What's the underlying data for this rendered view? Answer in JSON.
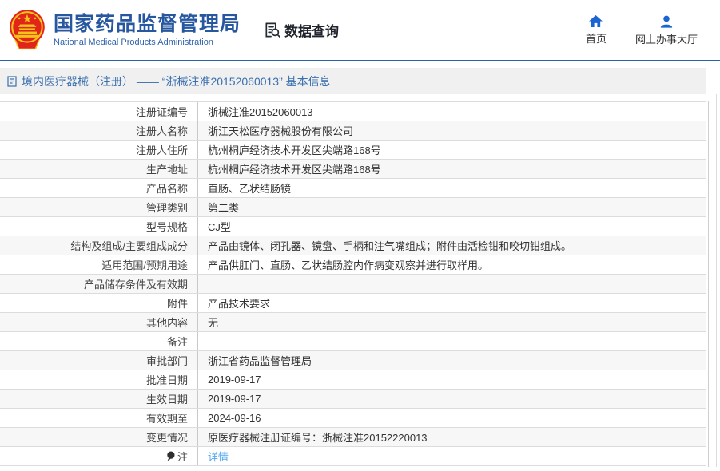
{
  "header": {
    "org_title": "国家药品监督管理局",
    "org_subtitle": "National Medical Products Administration",
    "section_title": "数据查询",
    "nav": [
      {
        "label": "首页",
        "icon": "home-icon"
      },
      {
        "label": "网上办事大厅",
        "icon": "user-icon"
      }
    ]
  },
  "breadcrumb": {
    "icon": "document-icon",
    "text": "境内医疗器械（注册） —— “浙械注准20152060013” 基本信息"
  },
  "table": {
    "rows": [
      {
        "label": "注册证编号",
        "value": "浙械注准20152060013"
      },
      {
        "label": "注册人名称",
        "value": "浙江天松医疗器械股份有限公司"
      },
      {
        "label": "注册人住所",
        "value": "杭州桐庐经济技术开发区尖端路168号"
      },
      {
        "label": "生产地址",
        "value": "杭州桐庐经济技术开发区尖端路168号"
      },
      {
        "label": "产品名称",
        "value": "直肠、乙状结肠镜"
      },
      {
        "label": "管理类别",
        "value": "第二类"
      },
      {
        "label": "型号规格",
        "value": "CJ型"
      },
      {
        "label": "结构及组成/主要组成成分",
        "value": "产品由镜体、闭孔器、镜盘、手柄和注气嘴组成；附件由活检钳和咬切钳组成。"
      },
      {
        "label": "适用范围/预期用途",
        "value": "产品供肛门、直肠、乙状结肠腔内作病变观察并进行取样用。"
      },
      {
        "label": "产品储存条件及有效期",
        "value": ""
      },
      {
        "label": "附件",
        "value": "产品技术要求"
      },
      {
        "label": "其他内容",
        "value": "无"
      },
      {
        "label": "备注",
        "value": ""
      },
      {
        "label": "审批部门",
        "value": "浙江省药品监督管理局"
      },
      {
        "label": "批准日期",
        "value": "2019-09-17"
      },
      {
        "label": "生效日期",
        "value": "2019-09-17"
      },
      {
        "label": "有效期至",
        "value": "2024-09-16"
      },
      {
        "label": "变更情况",
        "value": "原医疗器械注册证编号：浙械注准20152220013"
      },
      {
        "label": "注",
        "value": "详情",
        "link": true,
        "label_icon": "note-icon"
      }
    ]
  },
  "colors": {
    "brand_blue": "#27579f",
    "nav_icon_blue": "#1b64d2",
    "divider_blue": "#2a62a8",
    "breadcrumb_blue": "#3a6fae",
    "link_blue": "#54a8f0",
    "row_alt_gray": "#f7f7f7",
    "emblem_red": "#e1251b",
    "emblem_gold": "#f6c418"
  }
}
